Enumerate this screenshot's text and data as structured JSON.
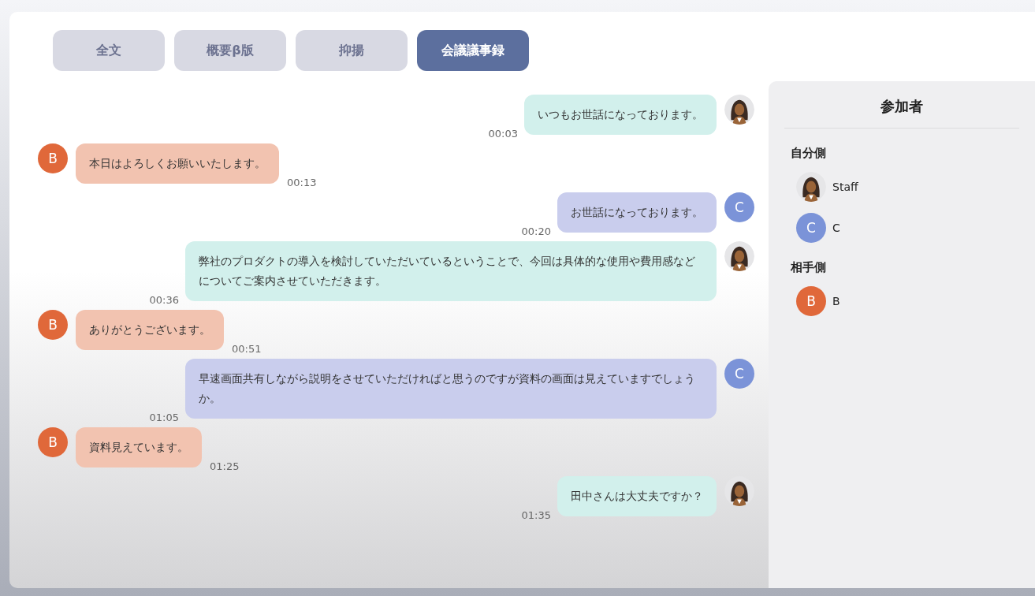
{
  "tabs": [
    {
      "label": "全文",
      "selected": false
    },
    {
      "label": "概要β版",
      "selected": false
    },
    {
      "label": "抑揚",
      "selected": false
    },
    {
      "label": "会議議事録",
      "selected": true
    }
  ],
  "messages": [
    {
      "kind": "self",
      "avatar": {
        "kind": "photo"
      },
      "text": "いつもお世話になっております。",
      "time": "00:03"
    },
    {
      "kind": "other",
      "avatar": {
        "kind": "letter",
        "letter": "B",
        "color": "#e0683a"
      },
      "text": "本日はよろしくお願いいたします。",
      "time": "00:13"
    },
    {
      "kind": "self",
      "avatar": {
        "kind": "letter",
        "letter": "C",
        "color": "#7b93d8"
      },
      "text": "お世話になっております。",
      "time": "00:20"
    },
    {
      "kind": "self",
      "avatar": {
        "kind": "photo"
      },
      "text": "弊社のプロダクトの導入を検討していただいているということで、今回は具体的な使用や費用感などについてご案内させていただきます。",
      "time": "00:36"
    },
    {
      "kind": "other",
      "avatar": {
        "kind": "letter",
        "letter": "B",
        "color": "#e0683a"
      },
      "text": "ありがとうございます。",
      "time": "00:51"
    },
    {
      "kind": "self",
      "avatar": {
        "kind": "letter",
        "letter": "C",
        "color": "#7b93d8"
      },
      "text": "早速画面共有しながら説明をさせていただければと思うのですが資料の画面は見えていますでしょうか。",
      "time": "01:05"
    },
    {
      "kind": "other",
      "avatar": {
        "kind": "letter",
        "letter": "B",
        "color": "#e0683a"
      },
      "text": "資料見えています。",
      "time": "01:25"
    },
    {
      "kind": "self",
      "avatar": {
        "kind": "photo"
      },
      "text": "田中さんは大丈夫ですか？",
      "time": "01:35"
    }
  ],
  "participants": {
    "title": "参加者",
    "groups": [
      {
        "heading": "自分側",
        "members": [
          {
            "avatar": {
              "kind": "photo"
            },
            "name": "Staff"
          },
          {
            "avatar": {
              "kind": "letter",
              "letter": "C",
              "color": "#7b93d8"
            },
            "name": "C"
          }
        ]
      },
      {
        "heading": "相手側",
        "members": [
          {
            "avatar": {
              "kind": "letter",
              "letter": "B",
              "color": "#e0683a"
            },
            "name": "B"
          }
        ]
      }
    ]
  }
}
